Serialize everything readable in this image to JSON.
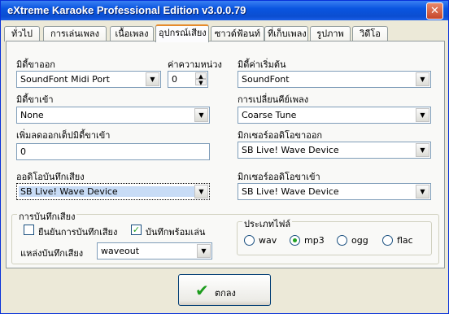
{
  "window": {
    "title": "eXtreme Karaoke Professional Edition v3.0.0.79",
    "close_glyph": "✕"
  },
  "tabs": [
    {
      "label": "ทั่วไป"
    },
    {
      "label": "การเล่นเพลง"
    },
    {
      "label": "เนื้อเพลง"
    },
    {
      "label": "อุปกรณ์เสียง"
    },
    {
      "label": "ซาวด์ฟ้อนท์"
    },
    {
      "label": "ที่เก็บเพลง"
    },
    {
      "label": "รูปภาพ"
    },
    {
      "label": "วิดีโอ"
    }
  ],
  "active_tab": "อุปกรณ์เสียง",
  "midi_out": {
    "label": "มิดี้ขาออก",
    "value": "SoundFont Midi Port"
  },
  "delay": {
    "label": "ค่าความหน่วง",
    "value": "0"
  },
  "default_midi": {
    "label": "มิดี้ค่าเริ่มต้น",
    "value": "SoundFont"
  },
  "midi_in": {
    "label": "มิดี้ขาเข้า",
    "value": "None"
  },
  "key_change": {
    "label": "การเปลี่ยนคีย์เพลง",
    "value": "Coarse Tune"
  },
  "midi_in_offset": {
    "label": "เพิ่มลดออกเต็ปมิดี้ขาเข้า",
    "value": "0"
  },
  "mixer_out": {
    "label": "มิกเซอร์ออดิโอขาออก",
    "value": "SB Live! Wave Device"
  },
  "record_audio": {
    "label": "ออดิโอบันทึกเสียง",
    "value": "SB Live! Wave Device"
  },
  "mixer_in": {
    "label": "มิกเซอร์ออดิโอขาเข้า",
    "value": "SB Live! Wave Device"
  },
  "recording": {
    "group_label": "การบันทึกเสียง",
    "confirm_label": "ยืนยันการบันทึกเสียง",
    "confirm_checked": false,
    "record_play_label": "บันทึกพร้อมเล่น",
    "record_play_checked": true,
    "check_glyph": "✓",
    "source_label": "แหล่งบันทึกเสียง",
    "source_value": "waveout"
  },
  "file_type": {
    "group_label": "ประเภทไฟล์",
    "options": [
      "wav",
      "mp3",
      "ogg",
      "flac"
    ],
    "selected": "mp3"
  },
  "ok_button": {
    "label": "ตกลง",
    "icon": "check-icon",
    "glyph": "✔"
  },
  "arrow_glyph": "▼",
  "spin_up": "▲",
  "spin_down": "▼",
  "colors": {
    "titlebar": "#0a55e0",
    "face": "#ece9d8",
    "active_tab_accent": "#e68b2c",
    "check": "#21a121"
  }
}
